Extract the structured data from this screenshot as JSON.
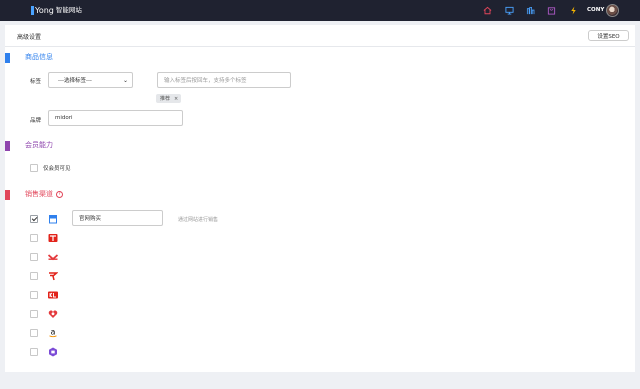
{
  "brand": {
    "name": "Yong",
    "subtitle": "智能网站"
  },
  "topbar": {
    "icons": [
      "home-icon",
      "monitor-icon",
      "chart-icon",
      "bag-icon",
      "bolt-icon"
    ],
    "username": "CONY"
  },
  "page": {
    "title": "高级设置",
    "seo_button": "设置SEO"
  },
  "colors": {
    "blue": "#2f80ed",
    "purple": "#8e44ad",
    "red": "#e1465a",
    "topbar": "#1f2230"
  },
  "product_info": {
    "title": "商品信息",
    "tag_label": "标签",
    "tag_select_value": "---选择标签---",
    "tag_input_placeholder": "输入标签后按回车，支持多个标签",
    "tags": [
      "推荐"
    ],
    "brand_label": "品牌",
    "brand_value": "midori"
  },
  "membership": {
    "title": "会员能力",
    "members_only_label": "仅会员可见",
    "members_only_checked": false
  },
  "sales_channels": {
    "title": "销售渠道",
    "info_icon": "?",
    "items": [
      {
        "icon": "store-icon",
        "checked": true,
        "name": "官网购买",
        "hint": "通过网站进行销售"
      },
      {
        "icon": "tmall-icon",
        "checked": false
      },
      {
        "icon": "vip-icon",
        "checked": false
      },
      {
        "icon": "jd-icon",
        "checked": false
      },
      {
        "icon": "kaola-icon",
        "checked": false
      },
      {
        "icon": "youzan-icon",
        "checked": false
      },
      {
        "icon": "amazon-icon",
        "checked": false
      },
      {
        "icon": "xiaohongshu-icon",
        "checked": false
      }
    ]
  }
}
